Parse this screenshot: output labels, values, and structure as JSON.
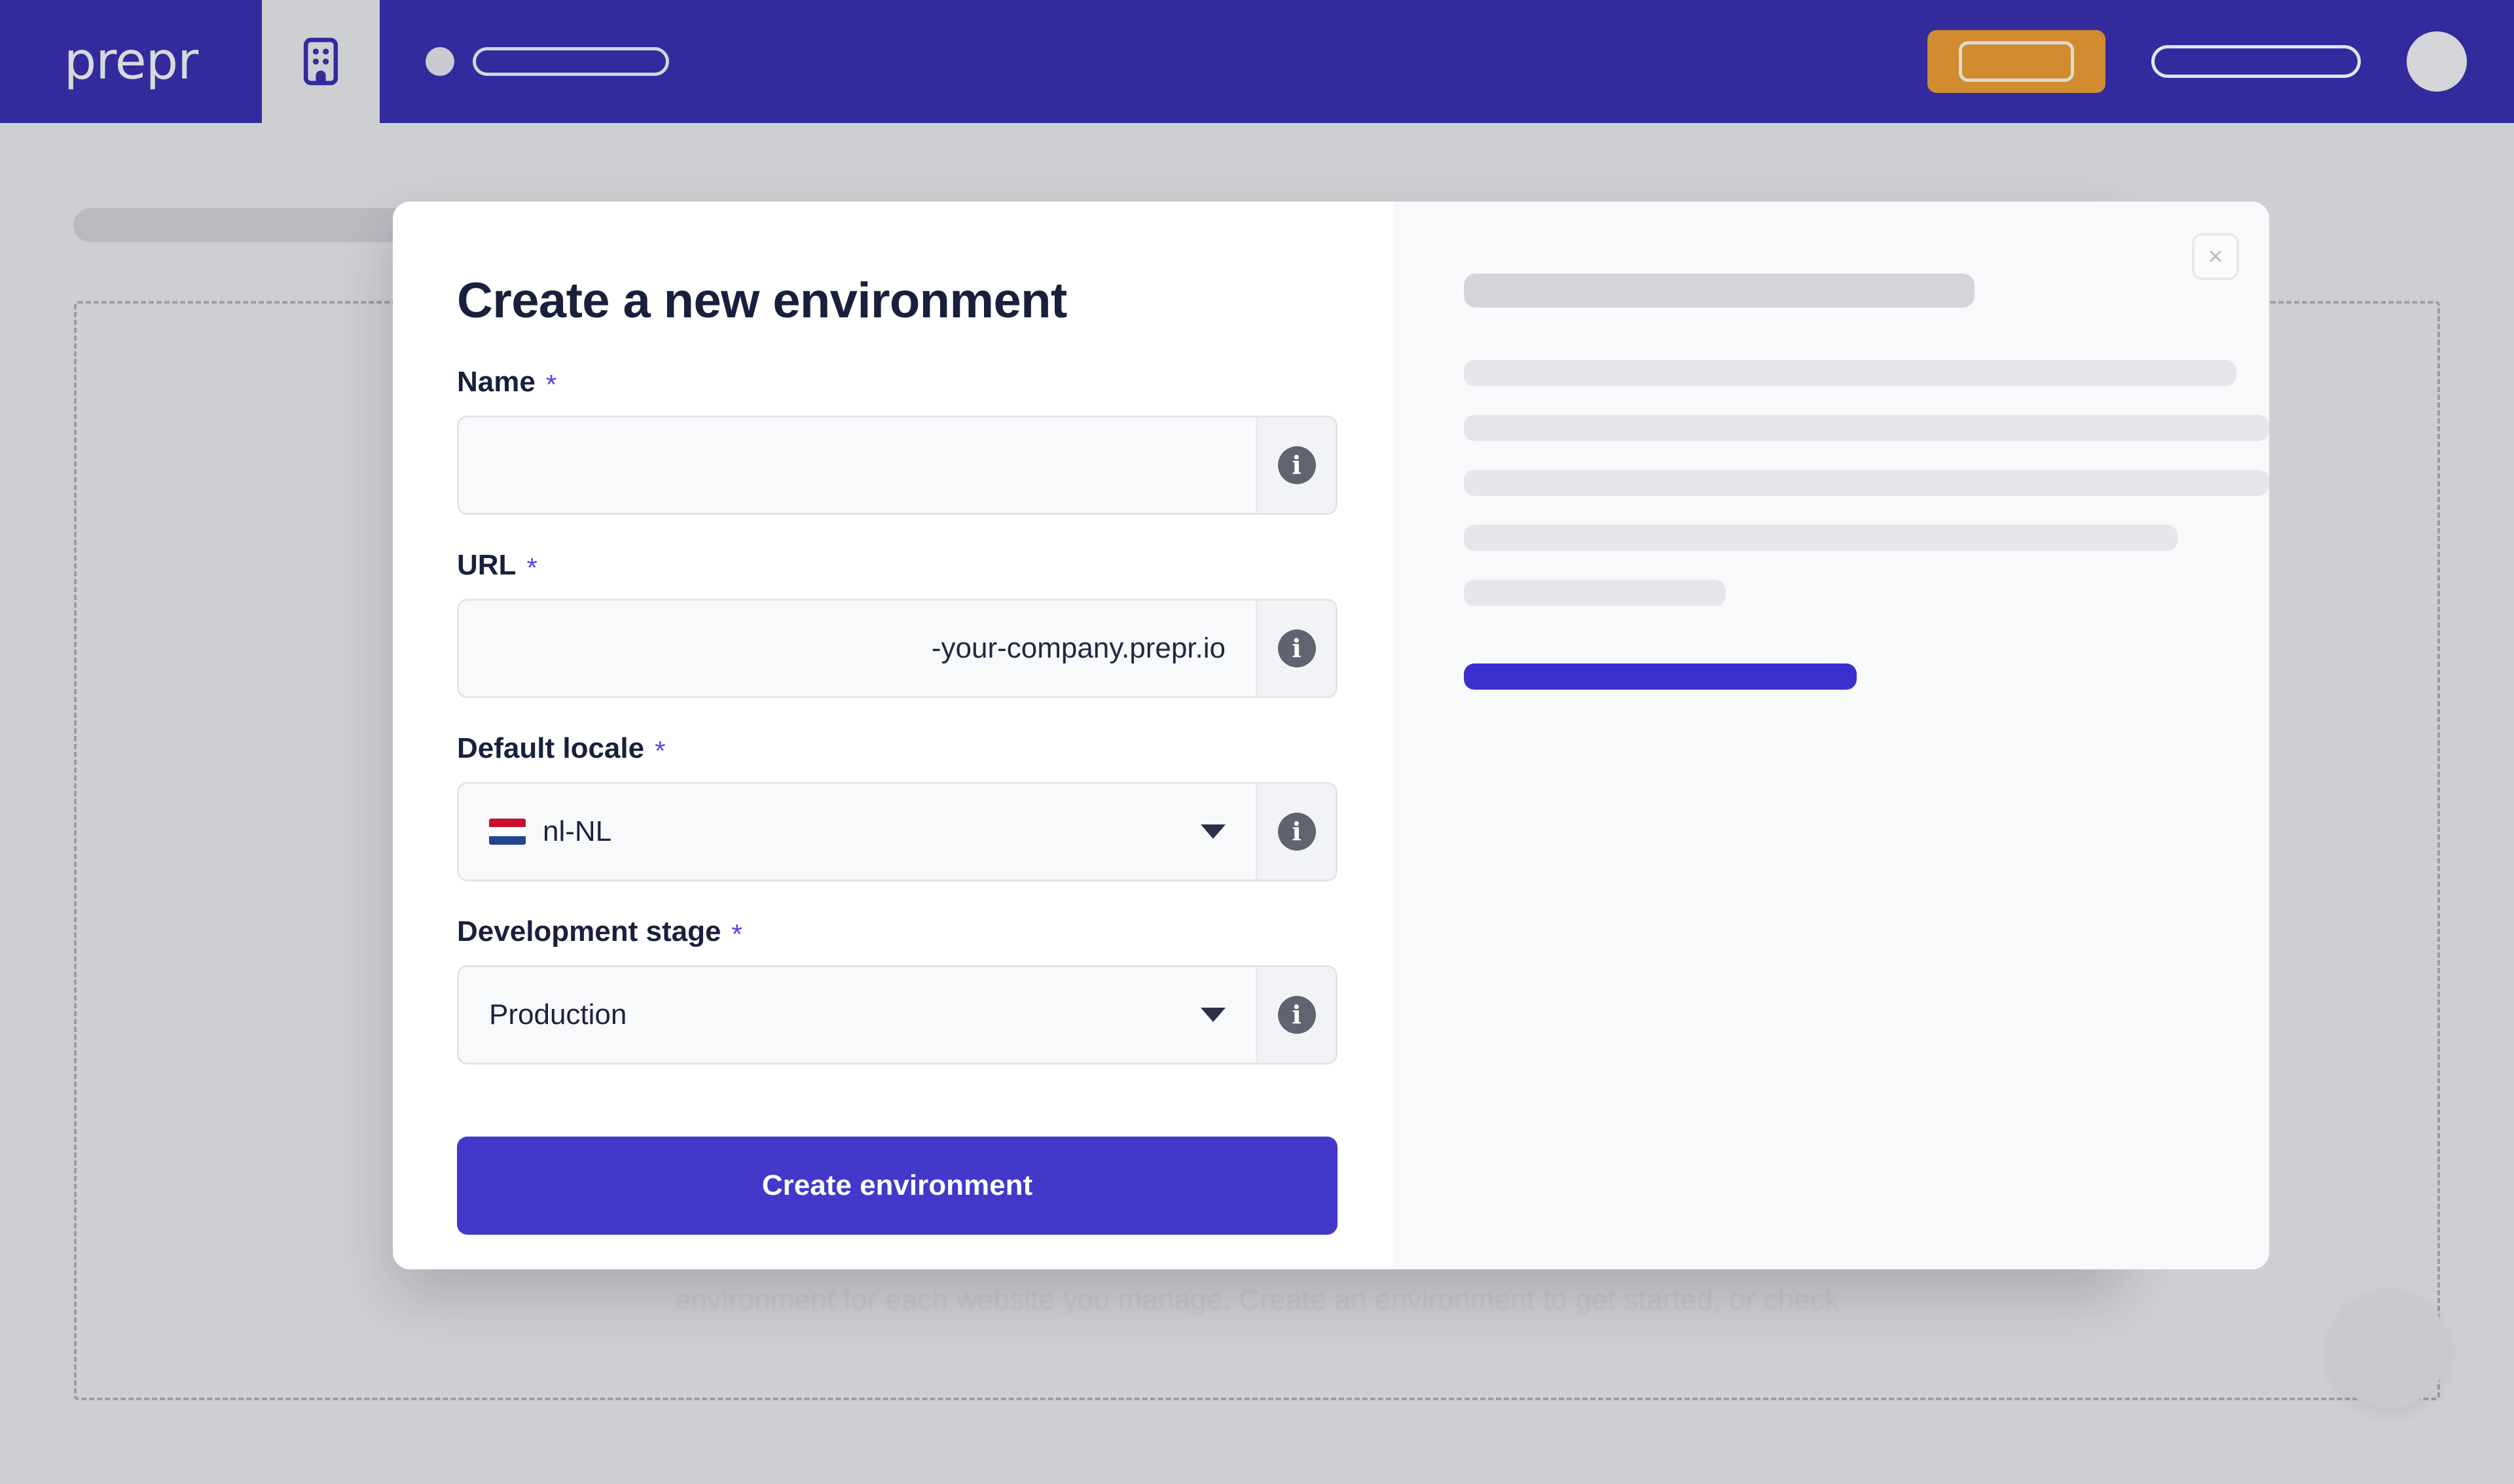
{
  "topbar": {
    "brand": "prepr",
    "org_icon": "building-icon",
    "placeholders": {
      "dot": "avatar-placeholder",
      "pill": "breadcrumb-placeholder",
      "cta": "cta-placeholder",
      "pill2": "nav-placeholder",
      "avatar": "user-avatar-placeholder"
    }
  },
  "background": {
    "faded_text": "environment for each website you manage. Create an environment to get started, or check",
    "help_bubble": "help-bubble"
  },
  "modal": {
    "title": "Create a new environment",
    "close_label": "×",
    "required_marker": "*",
    "fields": [
      {
        "key": "name",
        "label": "Name",
        "required": true,
        "value": "",
        "placeholder": "",
        "info": "i"
      },
      {
        "key": "url",
        "label": "URL",
        "required": true,
        "value": "",
        "placeholder": "",
        "suffix": "-your-company.prepr.io",
        "info": "i"
      },
      {
        "key": "locale",
        "label": "Default locale",
        "required": true,
        "value": "nl-NL",
        "flag": "flag-nl",
        "info": "i"
      },
      {
        "key": "stage",
        "label": "Development stage",
        "required": true,
        "value": "Production",
        "info": "i"
      }
    ],
    "submit_label": "Create environment",
    "side_panel": {
      "skeleton_title_width": 780,
      "skeleton_lines": [
        1180,
        1230,
        1230,
        1090,
        400
      ],
      "skeleton_cta_width": 600
    }
  },
  "colors": {
    "brand_purple": "#332a9e",
    "accent_purple": "#4338ca",
    "required_star": "#4f46e5",
    "page_bg": "#cdcfd2",
    "modal_bg": "#ffffff",
    "panel_bg": "#f8f9fb",
    "cta_orange": "#d08c2e",
    "flag_red": "#c8102e",
    "flag_white": "#ffffff",
    "flag_blue": "#21468b"
  }
}
